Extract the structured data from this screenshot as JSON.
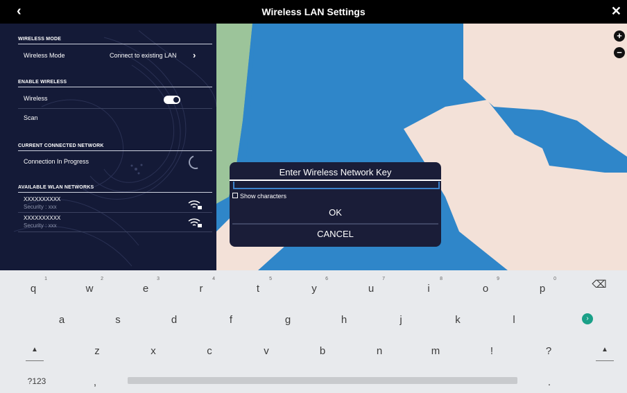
{
  "window": {
    "title": "Wireless LAN Settings",
    "back_glyph": "‹",
    "close_glyph": "✕"
  },
  "panel": {
    "wireless_mode_header": "WIRELESS MODE",
    "wireless_mode_label": "Wireless Mode",
    "wireless_mode_value": "Connect to existing LAN",
    "enable_wireless_header": "ENABLE WIRELESS",
    "wireless_label": "Wireless",
    "wireless_enabled": true,
    "scan_label": "Scan",
    "current_network_header": "CURRENT CONNECTED NETWORK",
    "connection_status": "Connection In Progress",
    "available_header": "AVAILABLE WLAN NETWORKS",
    "networks": [
      {
        "ssid": "XXXXXXXXXX",
        "security": "Security : xxx"
      },
      {
        "ssid": "XXXXXXXXXX",
        "security": "Security : xxx"
      }
    ]
  },
  "map": {
    "zoom_in": "+",
    "zoom_out": "−"
  },
  "dialog": {
    "title": "Enter Wireless Network Key",
    "input_value": "",
    "show_characters_label": "Show characters",
    "show_characters_checked": false,
    "ok_label": "OK",
    "cancel_label": "CANCEL"
  },
  "keyboard": {
    "row1": [
      "q",
      "w",
      "e",
      "r",
      "t",
      "y",
      "u",
      "i",
      "o",
      "p"
    ],
    "row1_hints": [
      "1",
      "2",
      "3",
      "4",
      "5",
      "6",
      "7",
      "8",
      "9",
      "0"
    ],
    "row2": [
      "a",
      "s",
      "d",
      "f",
      "g",
      "h",
      "j",
      "k",
      "l"
    ],
    "row3": [
      "z",
      "x",
      "c",
      "v",
      "b",
      "n",
      "m",
      "!",
      "?"
    ],
    "symbols_label": "?123",
    "comma_label": ",",
    "period_label": ".",
    "backspace_icon": "⌫",
    "enter_icon": "›",
    "shift_icon": "▲"
  },
  "colors": {
    "title_bg": "#000000",
    "panel_bg": "#141a37",
    "water": "#2f86c9",
    "land": "#f3e1d8",
    "green": "#9cc49a",
    "accent": "#3d83cc",
    "enter_key": "#1aa088"
  }
}
